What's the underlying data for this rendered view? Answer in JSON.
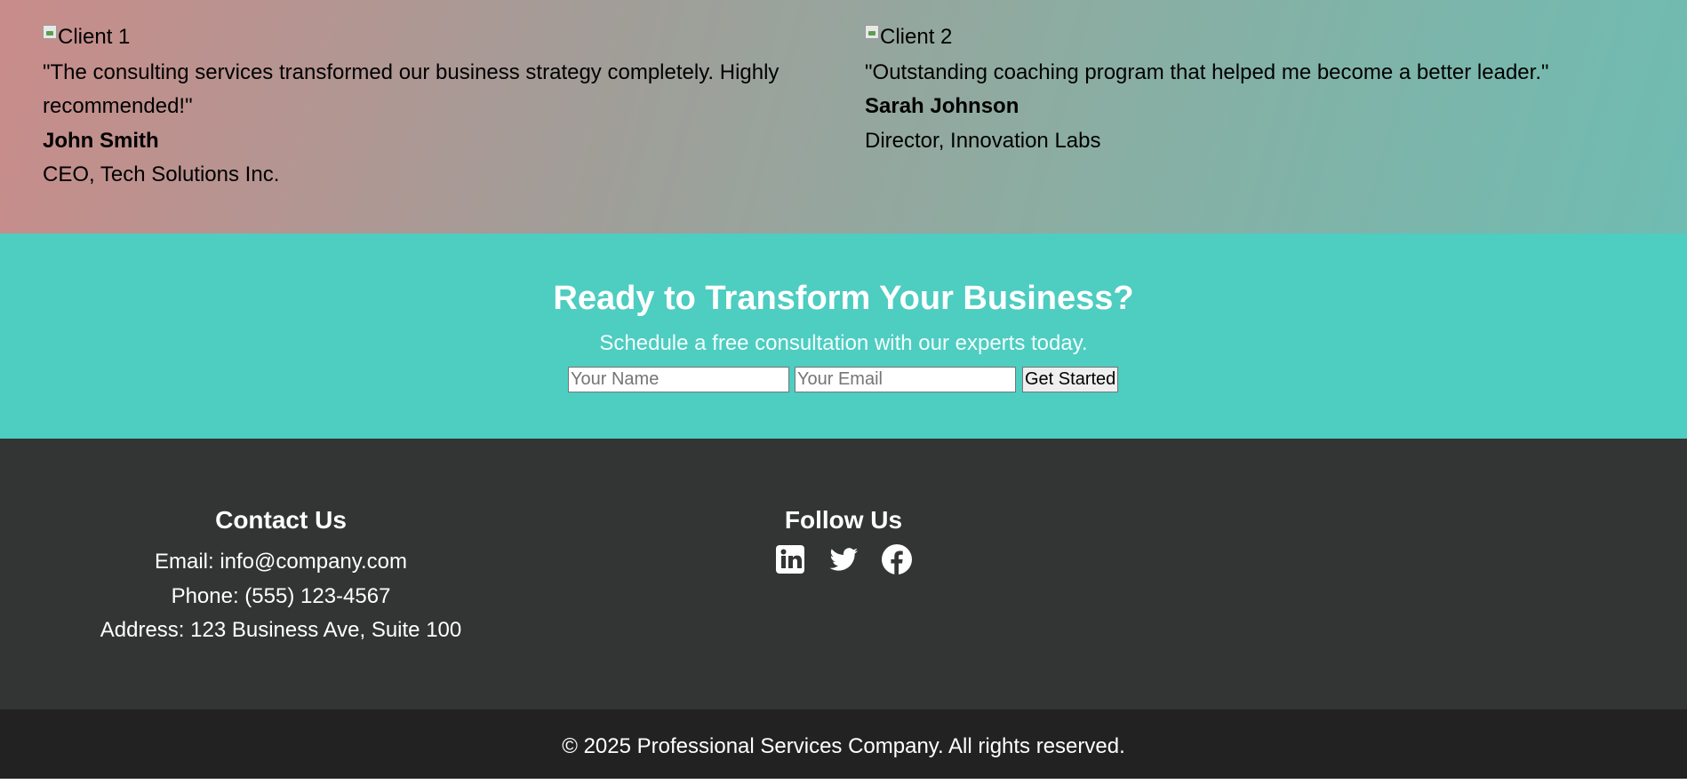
{
  "testimonials": [
    {
      "image_alt": "Client 1",
      "quote": "\"The consulting services transformed our business strategy completely. Highly recommended!\"",
      "name": "John Smith",
      "title": "CEO, Tech Solutions Inc."
    },
    {
      "image_alt": "Client 2",
      "quote": "\"Outstanding coaching program that helped me become a better leader.\"",
      "name": "Sarah Johnson",
      "title": "Director, Innovation Labs"
    }
  ],
  "cta": {
    "heading": "Ready to Transform Your Business?",
    "subheading": "Schedule a free consultation with our experts today.",
    "name_placeholder": "Your Name",
    "email_placeholder": "Your Email",
    "button_label": "Get Started",
    "background": "#4ecdc1"
  },
  "footer": {
    "contact": {
      "heading": "Contact Us",
      "email": "Email: info@company.com",
      "phone": "Phone: (555) 123-4567",
      "address": "Address: 123 Business Ave, Suite 100"
    },
    "follow": {
      "heading": "Follow Us",
      "icons": [
        "linkedin-icon",
        "twitter-icon",
        "facebook-icon"
      ]
    },
    "copyright": "© 2025 Professional Services Company. All rights reserved.",
    "background": "#333434",
    "copyright_background": "#222222"
  }
}
